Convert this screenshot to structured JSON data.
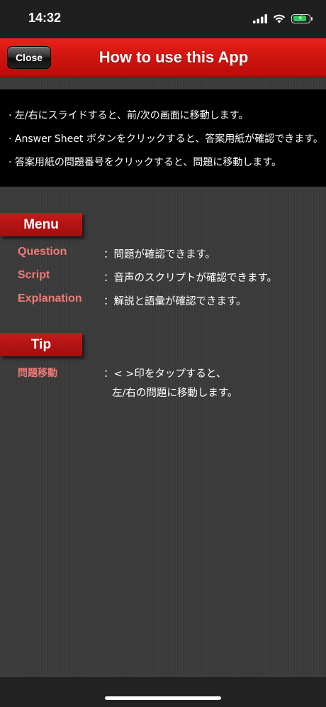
{
  "status_bar": {
    "time": "14:32",
    "battery_level": 0.9,
    "icons": [
      "signal-icon",
      "wifi-icon",
      "battery-charging-icon"
    ]
  },
  "nav": {
    "close_label": "Close",
    "title": "How to use this App",
    "color": "#d11510"
  },
  "instructions": [
    "· 左/右にスライドすると、前/次の画面に移動します。",
    "· Answer Sheet ボタンをクリックすると、答案用紙が確認できます。",
    "· 答案用紙の問題番号をクリックすると、問題に移動します。"
  ],
  "menu": {
    "header": "Menu",
    "items": [
      {
        "label": "Question",
        "desc": "：問題が確認できます。"
      },
      {
        "label": "Script",
        "desc": "：音声のスクリプトが確認できます。"
      },
      {
        "label": "Explanation",
        "desc": "：解説と語彙が確認できます。"
      }
    ]
  },
  "tip": {
    "header": "Tip",
    "items": [
      {
        "label": "問題移動",
        "desc_line1": "：< >印をタップすると、",
        "desc_line2": "左/右の問題に移動します。"
      }
    ]
  },
  "colors": {
    "accent_red": "#c61a1a",
    "label_pink": "#ef7a76",
    "background": "#3a3a3a"
  }
}
